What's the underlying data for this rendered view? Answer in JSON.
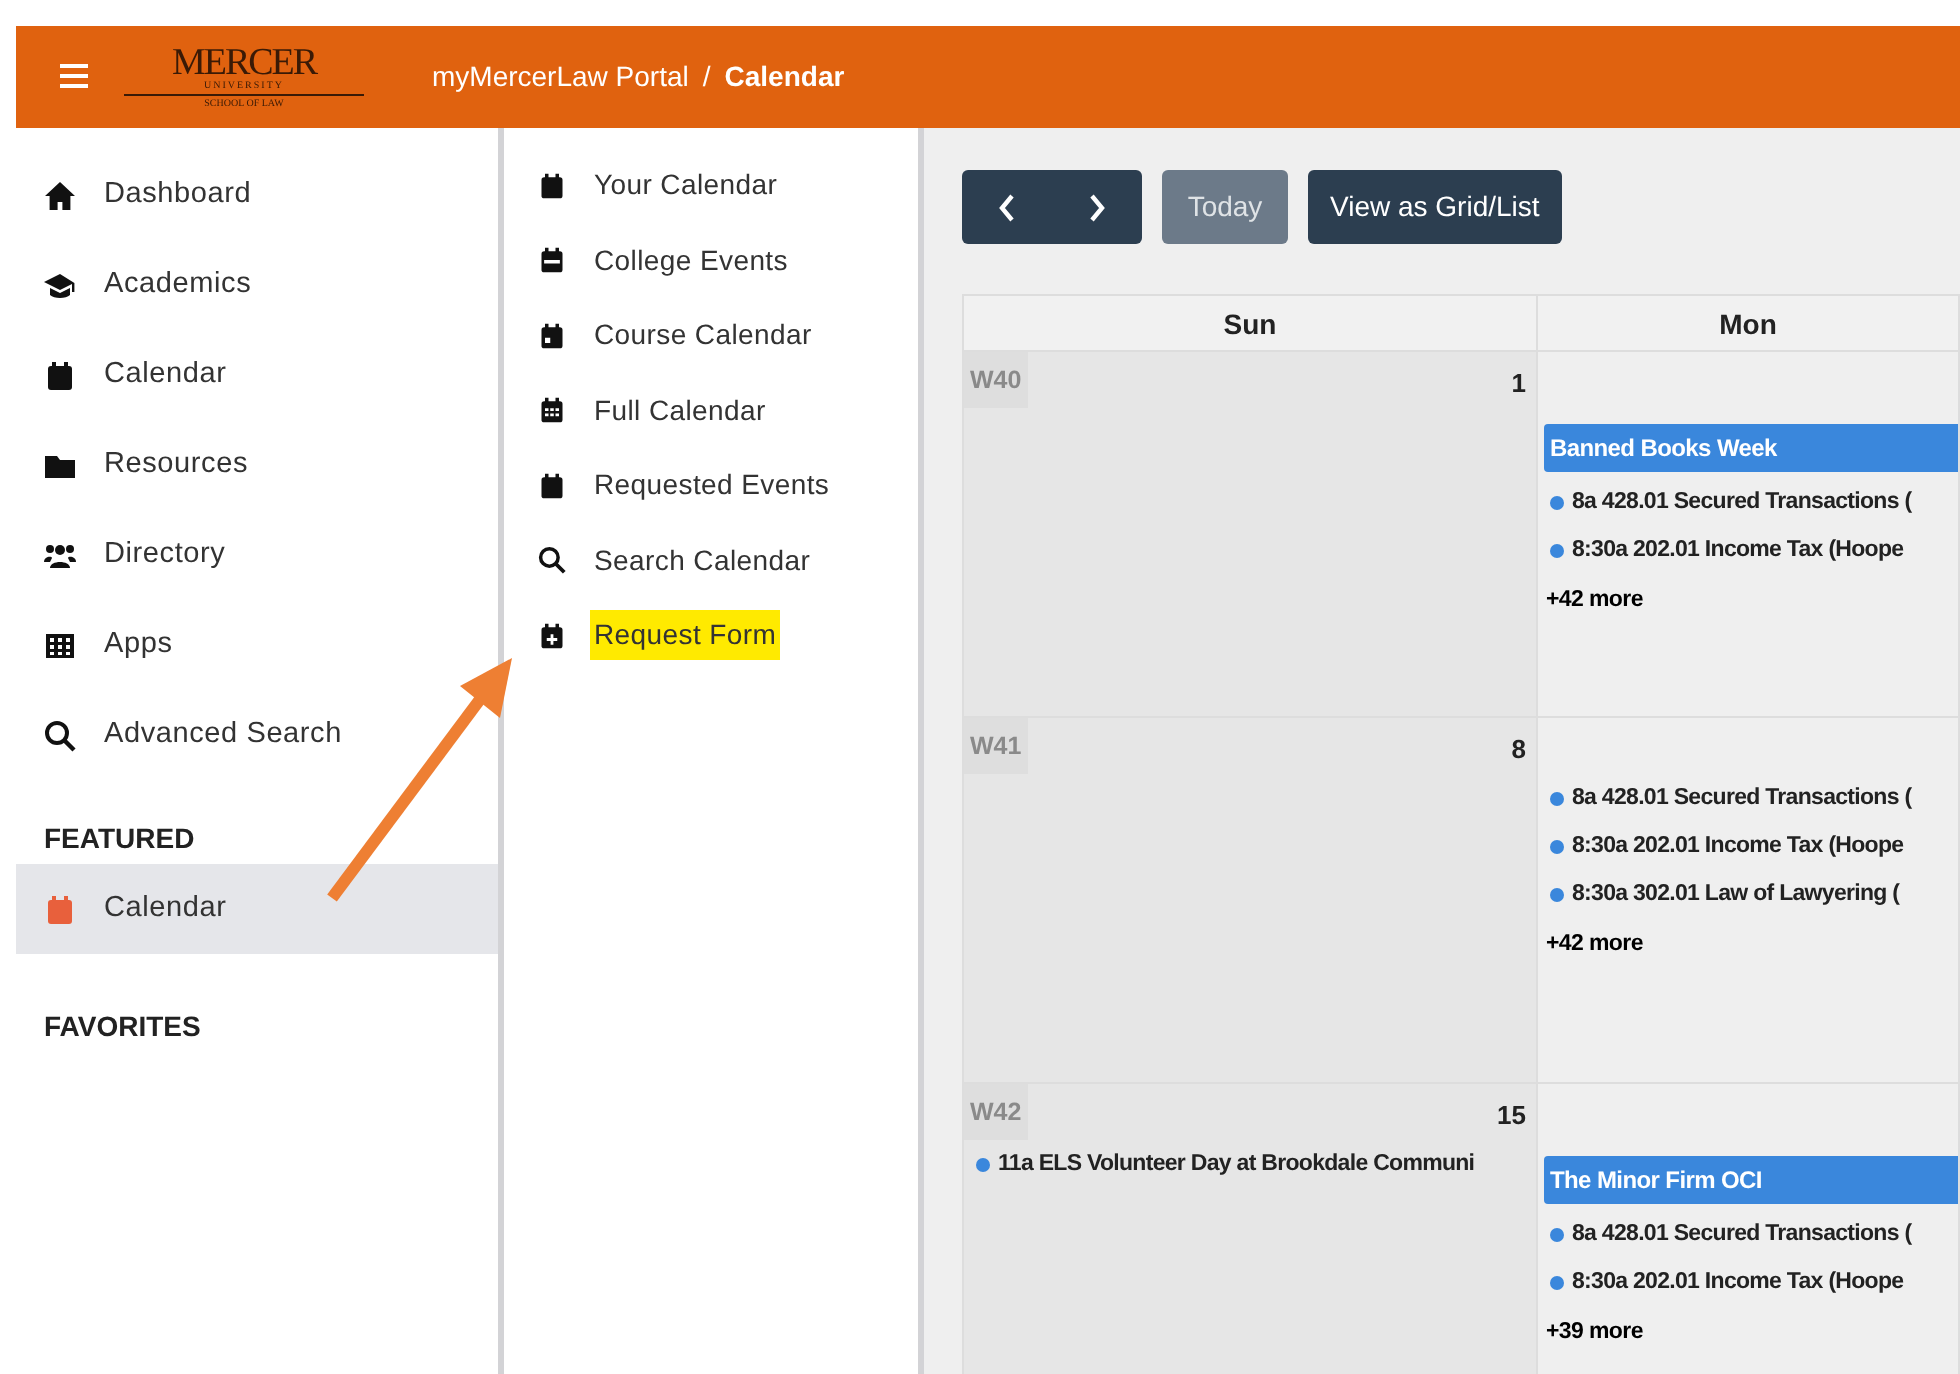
{
  "header": {
    "logo": {
      "title": "MERCER",
      "subtitle": "UNIVERSITY",
      "school": "SCHOOL OF LAW"
    },
    "breadcrumb": [
      {
        "label": "myMercerLaw Portal",
        "current": false
      },
      {
        "label": "Calendar",
        "current": true
      }
    ],
    "separator": "/"
  },
  "sidebar": {
    "items": [
      {
        "label": "Dashboard",
        "selected": false
      },
      {
        "label": "Academics",
        "selected": false
      },
      {
        "label": "Calendar",
        "selected": false
      },
      {
        "label": "Resources",
        "selected": false
      },
      {
        "label": "Directory",
        "selected": false
      },
      {
        "label": "Apps",
        "selected": false
      },
      {
        "label": "Advanced Search",
        "selected": false
      }
    ],
    "featured": {
      "heading": "FEATURED",
      "items": [
        {
          "label": "Calendar",
          "selected": true
        }
      ]
    },
    "favorites": {
      "heading": "FAVORITES"
    }
  },
  "submenu": {
    "items": [
      {
        "label": "Your Calendar",
        "highlighted": false
      },
      {
        "label": "College Events",
        "highlighted": false
      },
      {
        "label": "Course Calendar",
        "highlighted": false
      },
      {
        "label": "Full Calendar",
        "highlighted": false
      },
      {
        "label": "Requested Events",
        "highlighted": false
      },
      {
        "label": "Search Calendar",
        "highlighted": false
      },
      {
        "label": "Request Form",
        "highlighted": true
      }
    ]
  },
  "toolbar": {
    "today": {
      "label": "Today",
      "disabled": true
    },
    "view": {
      "label": "View as Grid/List"
    }
  },
  "calendar": {
    "columns": [
      "Sun",
      "Mon"
    ],
    "weeks": [
      {
        "label": "W40",
        "days": [
          {
            "date": "1"
          },
          {
            "banner": "Banned Books Week",
            "events": [
              "8a 428.01 Secured Transactions (",
              "8:30a 202.01 Income Tax (Hoope"
            ],
            "more": "+42 more"
          }
        ]
      },
      {
        "label": "W41",
        "days": [
          {
            "date": "8"
          },
          {
            "events": [
              "8a 428.01 Secured Transactions (",
              "8:30a 202.01 Income Tax (Hoope",
              "8:30a 302.01 Law of Lawyering ("
            ],
            "more": "+42 more"
          }
        ]
      },
      {
        "label": "W42",
        "days": [
          {
            "date": "15",
            "events": [
              "11a ELS Volunteer Day at Brookdale Communi"
            ]
          },
          {
            "banner": "The Minor Firm OCI",
            "events": [
              "8a 428.01 Secured Transactions (",
              "8:30a 202.01 Income Tax (Hoope"
            ],
            "more": "+39 more"
          }
        ]
      }
    ]
  }
}
